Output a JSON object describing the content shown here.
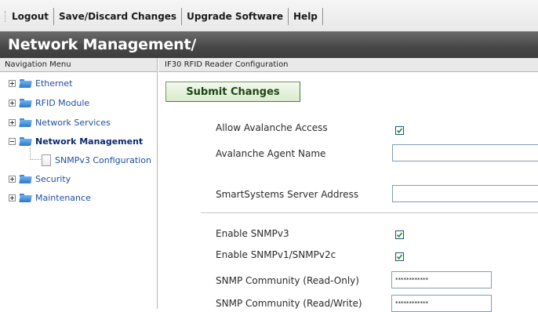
{
  "toolbar": {
    "buttons": [
      "Logout",
      "Save/Discard Changes",
      "Upgrade Software",
      "Help"
    ]
  },
  "title": "Network Management/",
  "nav": {
    "header": "Navigation Menu",
    "items": [
      {
        "label": "Ethernet",
        "expander": "plus"
      },
      {
        "label": "RFID Module",
        "expander": "plus"
      },
      {
        "label": "Network Services",
        "expander": "plus"
      },
      {
        "label": "Network Management",
        "expander": "minus",
        "selected": true
      },
      {
        "label": "SNMPv3 Configuration",
        "expander": "none",
        "child": true
      },
      {
        "label": "Security",
        "expander": "plus"
      },
      {
        "label": "Maintenance",
        "expander": "plus"
      }
    ]
  },
  "main": {
    "header": "IF30 RFID Reader Configuration",
    "submit_label": "Submit Changes",
    "fields": {
      "allow_avalanche": {
        "label": "Allow Avalanche Access",
        "checked": true
      },
      "agent_name": {
        "label": "Avalanche Agent Name",
        "value": ""
      },
      "smartsystems_addr": {
        "label": "SmartSystems Server Address",
        "value": ""
      },
      "enable_snmpv3": {
        "label": "Enable SNMPv3",
        "checked": true
      },
      "enable_snmpv1": {
        "label": "Enable SNMPv1/SNMPv2c",
        "checked": true
      },
      "community_ro": {
        "label": "SNMP Community (Read-Only)",
        "value": "************"
      },
      "community_rw": {
        "label": "SNMP Community (Read/Write)",
        "value": "************"
      }
    }
  },
  "colors": {
    "title_bar": "#474747",
    "nav_link": "#1f4fa0",
    "submit_bg": "#d9ebcc",
    "checkbox_border": "#1c5180",
    "checkmark": "#1a8a1a"
  }
}
